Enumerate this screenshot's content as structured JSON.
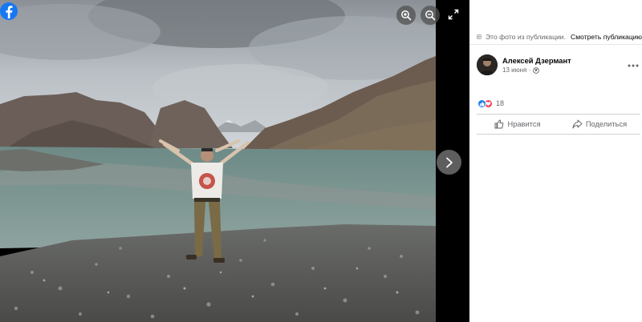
{
  "panel": {
    "source_text": "Это фото из публикации.",
    "source_link": "Смотреть публикацию",
    "author_name": "Алексей Дзермант",
    "post_date": "13 июня ·",
    "reaction_count": "18",
    "like_label": "Нравится",
    "share_label": "Поделиться"
  },
  "icons": {
    "logo": "facebook-logo",
    "zoom_in": "zoom-in-icon",
    "zoom_out": "zoom-out-icon",
    "fullscreen": "fullscreen-icon",
    "next": "chevron-right-icon",
    "more": "more-options-icon",
    "privacy": "globe-icon"
  },
  "colors": {
    "facebook_blue": "#1877f2",
    "love_red": "#f33e58",
    "secondary_text": "#65676b",
    "primary_text": "#050505"
  }
}
